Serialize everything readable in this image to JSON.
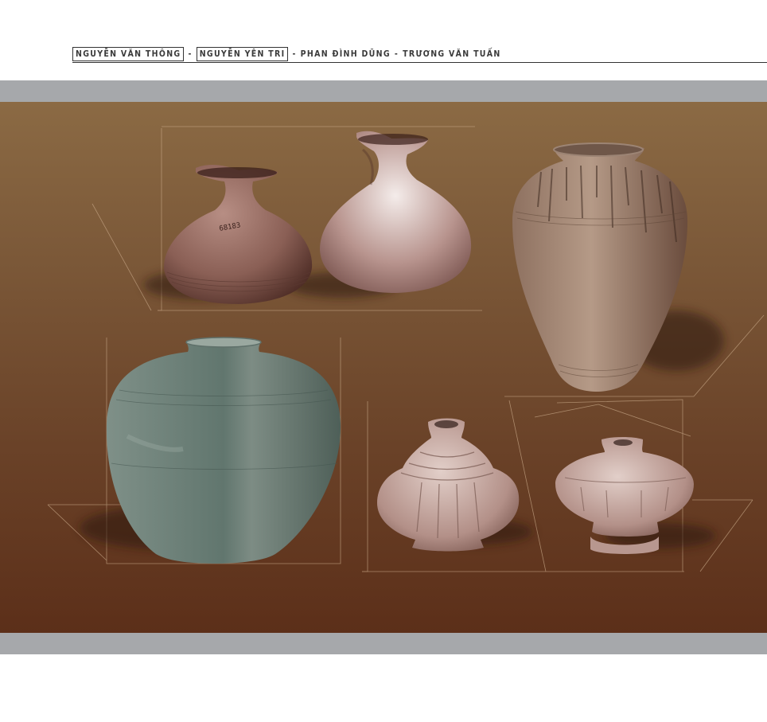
{
  "header": {
    "author_1": "NGUYỄN VĂN THÔNG",
    "author_2": "NGUYỄN YÊN TRI",
    "author_3": "PHAN ĐÌNH DŨNG",
    "author_4": "TRƯƠNG VĂN TUẤN",
    "separator": "-"
  },
  "figure": {
    "jar_inscription": "68183"
  },
  "colors": {
    "band_gray": "#a6a8ab",
    "plate_top": "#8b6a44",
    "plate_bottom": "#5c2f19"
  }
}
